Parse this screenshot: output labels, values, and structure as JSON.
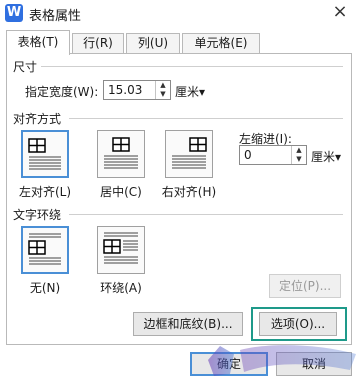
{
  "window": {
    "title": "表格属性",
    "app_icon": "W",
    "close": "×"
  },
  "tabs": [
    {
      "label": "表格(T)",
      "active": true
    },
    {
      "label": "行(R)",
      "active": false
    },
    {
      "label": "列(U)",
      "active": false
    },
    {
      "label": "单元格(E)",
      "active": false
    }
  ],
  "size": {
    "section_label": "尺寸",
    "width_label": "指定宽度(W):",
    "width_value": "15.03",
    "width_unit": "厘米▾"
  },
  "alignment": {
    "section_label": "对齐方式",
    "options": [
      {
        "label": "左对齐(L)",
        "selected": true
      },
      {
        "label": "居中(C)",
        "selected": false
      },
      {
        "label": "右对齐(H)",
        "selected": false
      }
    ],
    "indent_label": "左缩进(I):",
    "indent_value": "0",
    "indent_unit": "厘米▾"
  },
  "wrapping": {
    "section_label": "文字环绕",
    "options": [
      {
        "label": "无(N)",
        "selected": true
      },
      {
        "label": "环绕(A)",
        "selected": false
      }
    ],
    "position_button": "定位(P)..."
  },
  "buttons": {
    "borders": "边框和底纹(B)...",
    "options": "选项(O)...",
    "ok": "确定",
    "cancel": "取消"
  },
  "colors": {
    "accent": "#4a8fd6",
    "highlight": "#1e9a8a"
  }
}
